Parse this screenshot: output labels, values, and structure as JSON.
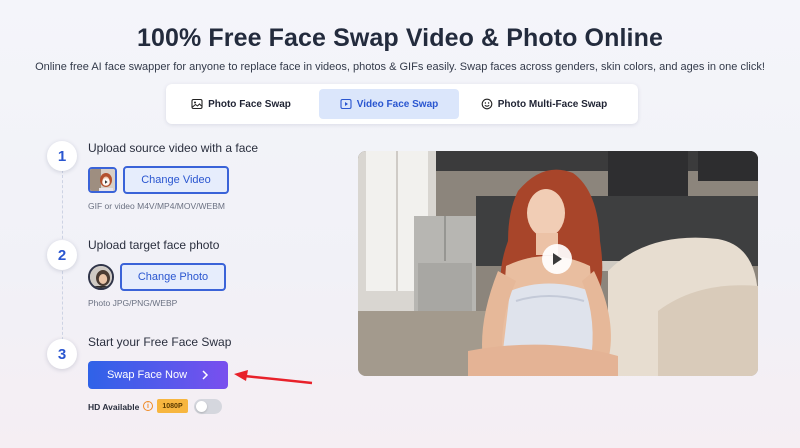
{
  "header": {
    "title": "100% Free Face Swap Video & Photo Online",
    "subtitle": "Online free AI face swapper for anyone to replace face in videos, photos & GIFs easily. Swap faces across genders, skin colors, and ages in one click!"
  },
  "tabs": [
    {
      "label": "Photo Face Swap",
      "icon": "image-icon",
      "active": false
    },
    {
      "label": "Video Face Swap",
      "icon": "video-icon",
      "active": true
    },
    {
      "label": "Photo Multi-Face Swap",
      "icon": "multi-face-icon",
      "active": false
    }
  ],
  "steps": [
    {
      "number": "1",
      "title": "Upload source video with a face",
      "button": "Change Video",
      "hint": "GIF or video M4V/MP4/MOV/WEBM"
    },
    {
      "number": "2",
      "title": "Upload target face photo",
      "button": "Change Photo",
      "hint": "Photo JPG/PNG/WEBP"
    },
    {
      "number": "3",
      "title": "Start your Free Face Swap",
      "button": "Swap Face Now"
    }
  ],
  "hd": {
    "label": "HD Available",
    "info_icon": "info-icon",
    "badge": "1080P",
    "enabled": false
  },
  "colors": {
    "accent": "#2a56d0",
    "button_start": "#2f62e8",
    "button_end": "#7a4fee",
    "arrow": "#e8212a",
    "badge": "#f7b63f"
  },
  "preview": {
    "play_icon": "play-icon"
  }
}
